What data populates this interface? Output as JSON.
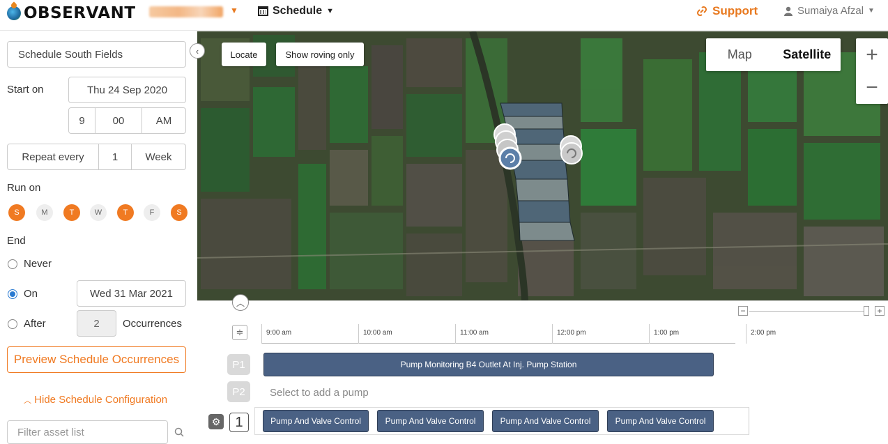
{
  "header": {
    "logo_text": "OBSERVANT",
    "schedule_menu": "Schedule",
    "support": "Support",
    "user": "Sumaiya Afzal"
  },
  "sidebar": {
    "schedule_name": "Schedule South Fields",
    "start_label": "Start on",
    "start_date": "Thu 24 Sep 2020",
    "start_hour": "9",
    "start_minute": "00",
    "start_ampm": "AM",
    "repeat_label": "Repeat every",
    "repeat_count": "1",
    "repeat_unit": "Week",
    "run_on_label": "Run on",
    "days": [
      {
        "label": "S",
        "on": true
      },
      {
        "label": "M",
        "on": false
      },
      {
        "label": "T",
        "on": true
      },
      {
        "label": "W",
        "on": false
      },
      {
        "label": "T",
        "on": true
      },
      {
        "label": "F",
        "on": false
      },
      {
        "label": "S",
        "on": true
      }
    ],
    "end_label": "End",
    "end_never": "Never",
    "end_on": "On",
    "end_on_date": "Wed 31 Mar 2021",
    "end_after": "After",
    "end_after_count": "2",
    "occurrences": "Occurrences",
    "end_selected": "On",
    "preview_button": "Preview Schedule Occurrences",
    "hide_config": "Hide Schedule Configuration",
    "filter_placeholder": "Filter asset list"
  },
  "map": {
    "locate": "Locate",
    "show_roving": "Show roving only",
    "type_map": "Map",
    "type_satellite": "Satellite",
    "selected_type": "Satellite",
    "zoom_in": "+",
    "zoom_out": "−"
  },
  "timeline": {
    "ticks": [
      "9:00 am",
      "10:00 am",
      "11:00 am",
      "12:00 pm",
      "1:00 pm",
      "2:00 pm"
    ],
    "p1_label": "P1",
    "p2_label": "P2",
    "p1_bar": "Pump Monitoring B4 Outlet At Inj. Pump Station",
    "p2_placeholder": "Select to add a pump",
    "row_number": "1",
    "row_bars": [
      "Pump And Valve Control",
      "Pump And Valve Control",
      "Pump And Valve Control",
      "Pump And Valve Control"
    ]
  },
  "colors": {
    "accent": "#f07a22",
    "bar": "#4a6184",
    "radio": "#2a7ad1"
  }
}
